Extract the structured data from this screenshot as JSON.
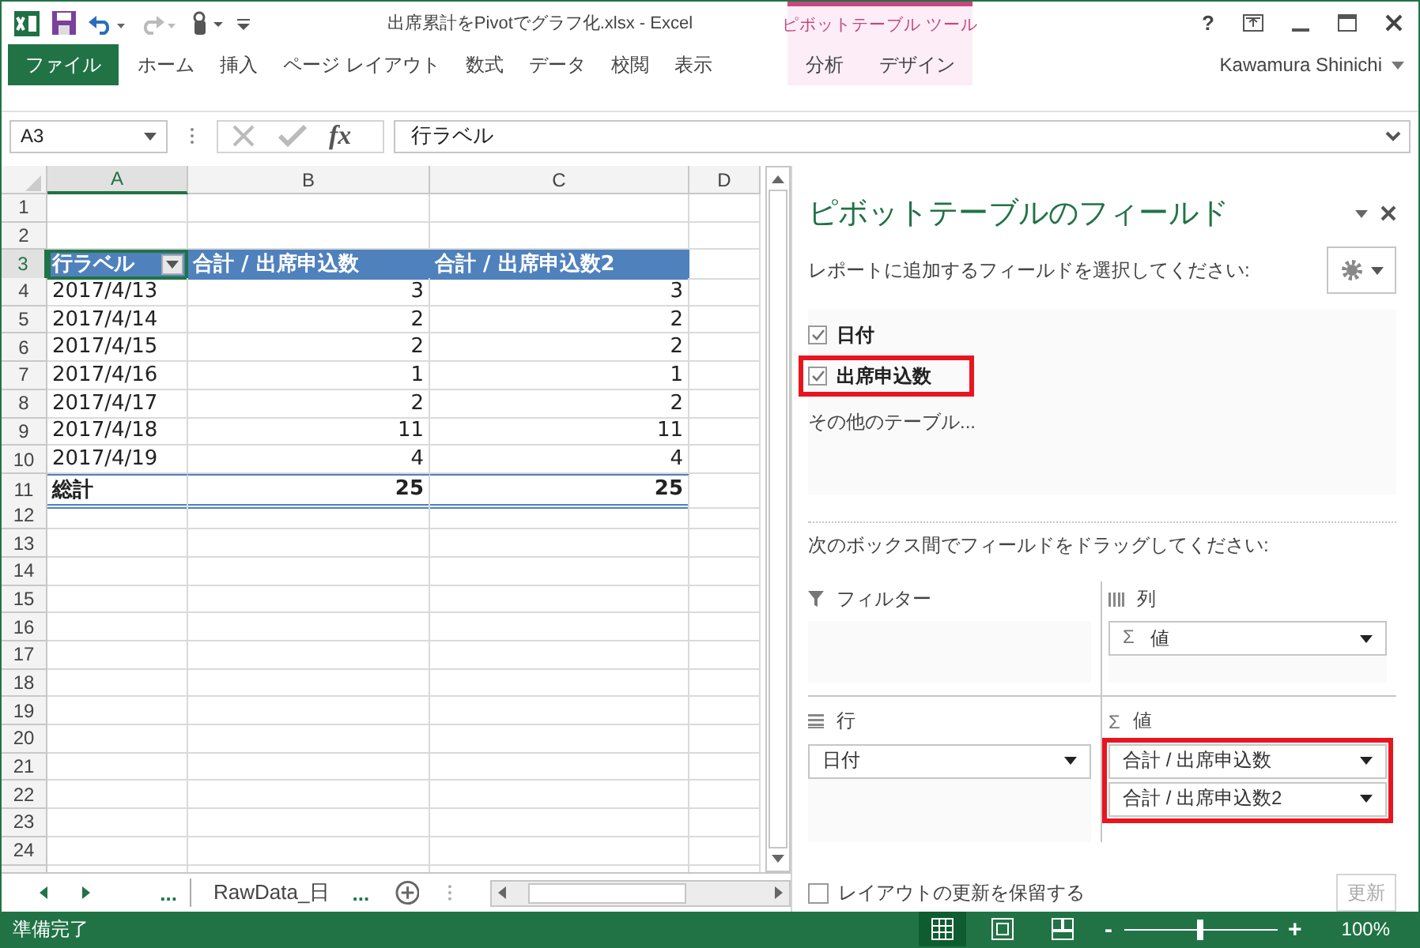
{
  "title_bar": {
    "title": "出席累計をPivotでグラフ化.xlsx - Excel",
    "context_group": "ピボットテーブル ツール",
    "help": "?"
  },
  "ribbon_tabs": [
    {
      "label": "ファイル",
      "kind": "file",
      "selected": false
    },
    {
      "label": "ホーム",
      "kind": "normal",
      "selected": false
    },
    {
      "label": "挿入",
      "kind": "normal",
      "selected": false
    },
    {
      "label": "ページ レイアウト",
      "kind": "normal",
      "selected": false
    },
    {
      "label": "数式",
      "kind": "normal",
      "selected": false
    },
    {
      "label": "データ",
      "kind": "normal",
      "selected": false
    },
    {
      "label": "校閲",
      "kind": "normal",
      "selected": false
    },
    {
      "label": "表示",
      "kind": "normal",
      "selected": false
    },
    {
      "label": "分析",
      "kind": "context",
      "selected": false
    },
    {
      "label": "デザイン",
      "kind": "context",
      "selected": false
    }
  ],
  "user": "Kawamura Shinichi",
  "formula_bar": {
    "name_box": "A3",
    "function_label": "fx",
    "value": "行ラベル"
  },
  "sheet": {
    "columns": [
      {
        "label": "A",
        "selected": true
      },
      {
        "label": "B",
        "selected": false
      },
      {
        "label": "C",
        "selected": false
      },
      {
        "label": "D",
        "selected": false
      }
    ],
    "rows": [
      {
        "number": "1",
        "selected": false,
        "kind": "blank"
      },
      {
        "number": "2",
        "selected": false,
        "kind": "blank"
      },
      {
        "number": "3",
        "selected": true,
        "kind": "header",
        "cells": [
          "行ラベル",
          "合計 / 出席申込数",
          "合計 / 出席申込数2"
        ]
      },
      {
        "number": "4",
        "selected": false,
        "kind": "data",
        "cells": [
          "2017/4/13",
          "3",
          "3"
        ]
      },
      {
        "number": "5",
        "selected": false,
        "kind": "data",
        "cells": [
          "2017/4/14",
          "2",
          "2"
        ]
      },
      {
        "number": "6",
        "selected": false,
        "kind": "data",
        "cells": [
          "2017/4/15",
          "2",
          "2"
        ]
      },
      {
        "number": "7",
        "selected": false,
        "kind": "data",
        "cells": [
          "2017/4/16",
          "1",
          "1"
        ]
      },
      {
        "number": "8",
        "selected": false,
        "kind": "data",
        "cells": [
          "2017/4/17",
          "2",
          "2"
        ]
      },
      {
        "number": "9",
        "selected": false,
        "kind": "data",
        "cells": [
          "2017/4/18",
          "11",
          "11"
        ]
      },
      {
        "number": "10",
        "selected": false,
        "kind": "data",
        "cells": [
          "2017/4/19",
          "4",
          "4"
        ]
      },
      {
        "number": "11",
        "selected": false,
        "kind": "total",
        "cells": [
          "総計",
          "25",
          "25"
        ]
      },
      {
        "number": "12",
        "selected": false,
        "kind": "blank"
      },
      {
        "number": "13",
        "selected": false,
        "kind": "blank"
      },
      {
        "number": "14",
        "selected": false,
        "kind": "blank"
      },
      {
        "number": "15",
        "selected": false,
        "kind": "blank"
      },
      {
        "number": "16",
        "selected": false,
        "kind": "blank"
      },
      {
        "number": "17",
        "selected": false,
        "kind": "blank"
      },
      {
        "number": "18",
        "selected": false,
        "kind": "blank"
      },
      {
        "number": "19",
        "selected": false,
        "kind": "blank"
      },
      {
        "number": "20",
        "selected": false,
        "kind": "blank"
      },
      {
        "number": "21",
        "selected": false,
        "kind": "blank"
      },
      {
        "number": "22",
        "selected": false,
        "kind": "blank"
      },
      {
        "number": "23",
        "selected": false,
        "kind": "blank"
      },
      {
        "number": "24",
        "selected": false,
        "kind": "blank"
      }
    ]
  },
  "sheet_tabs": {
    "more_before": "...",
    "tab": "RawData_日",
    "more_after": "..."
  },
  "pivot_pane": {
    "title": "ピボットテーブルのフィールド",
    "instruction": "レポートに追加するフィールドを選択してください:",
    "fields": [
      {
        "label": "日付",
        "checked": true,
        "highlighted": false
      },
      {
        "label": "出席申込数",
        "checked": true,
        "highlighted": true
      }
    ],
    "more_tables": "その他のテーブル...",
    "drag_instruction": "次のボックス間でフィールドをドラッグしてください:",
    "areas": [
      {
        "kind": "filter",
        "label": "フィルター",
        "highlighted": false
      },
      {
        "kind": "columns",
        "label": "列",
        "highlighted": false,
        "items": [
          {
            "symbol": "Σ",
            "label": "値"
          }
        ]
      },
      {
        "kind": "rows",
        "label": "行",
        "highlighted": false,
        "items": [
          {
            "label": "日付"
          }
        ]
      },
      {
        "kind": "values",
        "symbol": "Σ",
        "label": "値",
        "highlighted": true,
        "items": [
          {
            "label": "合計 / 出席申込数"
          },
          {
            "label": "合計 / 出席申込数2"
          }
        ]
      }
    ],
    "defer_update": {
      "label": "レイアウトの更新を保留する",
      "checked": false
    },
    "update_button": {
      "label": "更新",
      "disabled": true
    }
  },
  "status_bar": {
    "status": "準備完了",
    "views": [
      {
        "kind": "normal",
        "selected": true
      },
      {
        "kind": "page_layout",
        "selected": false
      },
      {
        "kind": "page_break",
        "selected": false
      }
    ],
    "zoom": {
      "minus": "-",
      "plus": "+",
      "level": 0.5,
      "reading": "100%"
    }
  }
}
